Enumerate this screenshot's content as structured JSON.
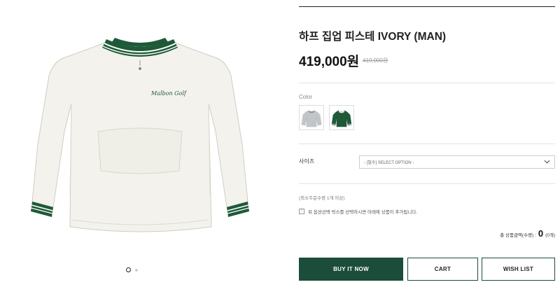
{
  "product": {
    "title": "하프 집업 피스테 IVORY (MAN)",
    "price": "419,000원",
    "original_price": "419,000원",
    "image_icon": "ivory-pullover-jacket-image",
    "chest_logo": "Malbon Golf"
  },
  "gallery": {
    "slides": 2,
    "active_slide": 1
  },
  "color": {
    "label": "Color",
    "options": [
      {
        "name": "ivory",
        "swatch_color": "#e8e8e8",
        "icon": "grey-jacket-swatch"
      },
      {
        "name": "green",
        "swatch_color": "#1e5a38",
        "icon": "green-jacket-swatch"
      }
    ]
  },
  "size": {
    "label": "사이즈",
    "selected": "- [필수] SELECT OPTION -"
  },
  "min_quantity": "(최소주문수량 1개 이상)",
  "notice": {
    "icon": "!",
    "text": "위 옵션선택 박스를 선택하시면 아래에 상품이 추가됩니다."
  },
  "total": {
    "label": "총 상품금액(수량) :",
    "value": "0",
    "unit": "(0개)"
  },
  "buttons": {
    "buy": "BUY IT NOW",
    "cart": "CART",
    "wishlist": "WISH LIST"
  },
  "colors": {
    "brand_green": "#1c4d3a",
    "jacket_body": "#f3f2ec"
  }
}
